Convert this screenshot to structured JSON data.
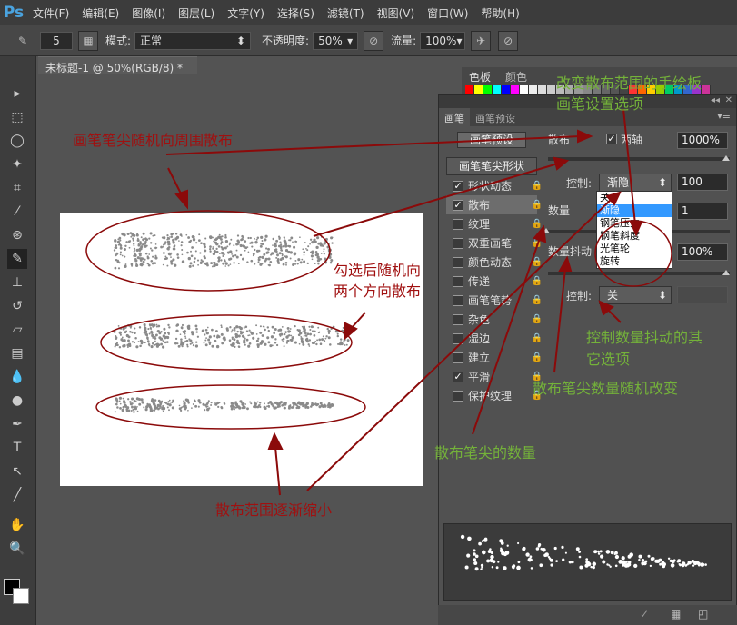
{
  "app": {
    "logo": "Ps"
  },
  "menu": [
    "文件(F)",
    "编辑(E)",
    "图像(I)",
    "图层(L)",
    "文字(Y)",
    "选择(S)",
    "滤镜(T)",
    "视图(V)",
    "窗口(W)",
    "帮助(H)"
  ],
  "options": {
    "brush_size": "5",
    "mode_label": "模式:",
    "mode_value": "正常",
    "opacity_label": "不透明度:",
    "opacity_value": "50%",
    "flow_label": "流量:",
    "flow_value": "100%"
  },
  "document_tab": "未标题-1 @ 50%(RGB/8) *",
  "swatch_panel": {
    "tabs": [
      "色板",
      "颜色"
    ],
    "colors": [
      "#ff0000",
      "#ffff00",
      "#00ff00",
      "#00ffff",
      "#0000ff",
      "#ff00ff",
      "#ffffff",
      "#eeeeee",
      "#dddddd",
      "#cccccc",
      "#bbbbbb",
      "#aaaaaa",
      "#999999",
      "#888888",
      "#777777",
      "#666666",
      "#555555",
      "#444444",
      "#ff3333",
      "#ff6600",
      "#ffcc00",
      "#99cc00",
      "#00cc66",
      "#0099cc",
      "#3366cc",
      "#9933cc",
      "#cc3399"
    ]
  },
  "brush_panel": {
    "tabs": [
      "画笔",
      "画笔预设"
    ],
    "preset_button": "画笔预设",
    "tip_shape_button": "画笔笔尖形状",
    "list": [
      {
        "label": "形状动态",
        "checked": true
      },
      {
        "label": "散布",
        "checked": true
      },
      {
        "label": "纹理",
        "checked": false
      },
      {
        "label": "双重画笔",
        "checked": false
      },
      {
        "label": "颜色动态",
        "checked": false
      },
      {
        "label": "传递",
        "checked": false
      },
      {
        "label": "画笔笔势",
        "checked": false
      },
      {
        "label": "杂色",
        "checked": false
      },
      {
        "label": "湿边",
        "checked": false
      },
      {
        "label": "建立",
        "checked": false
      },
      {
        "label": "平滑",
        "checked": true
      },
      {
        "label": "保护纹理",
        "checked": false
      }
    ],
    "scatter_label": "散布",
    "both_axes_label": "两轴",
    "scatter_value": "1000%",
    "control_label": "控制:",
    "control_value": "渐隐",
    "control_number": "100",
    "count_label": "数量",
    "count_value": "1",
    "count_jitter_label": "数量抖动",
    "count_jitter_value": "100%",
    "control2_label": "控制:",
    "control2_value": "关",
    "dropdown_options": [
      "关",
      "渐隐",
      "钢笔压力",
      "钢笔斜度",
      "光笔轮",
      "旋转"
    ],
    "dropdown_selected": "渐隐"
  },
  "annotations": {
    "a1": "画笔笔尖随机向周围散布",
    "a2_line1": "勾选后随机向",
    "a2_line2": "两个方向散布",
    "a3": "散布范围逐渐缩小",
    "a4_line1": "改变散布范围的手绘板",
    "a4_line2": "画笔设置选项",
    "a5_line1": "控制数量抖动的其",
    "a5_line2": "它选项",
    "a6": "散布笔尖数量随机改变",
    "a7": "散布笔尖的数量"
  }
}
